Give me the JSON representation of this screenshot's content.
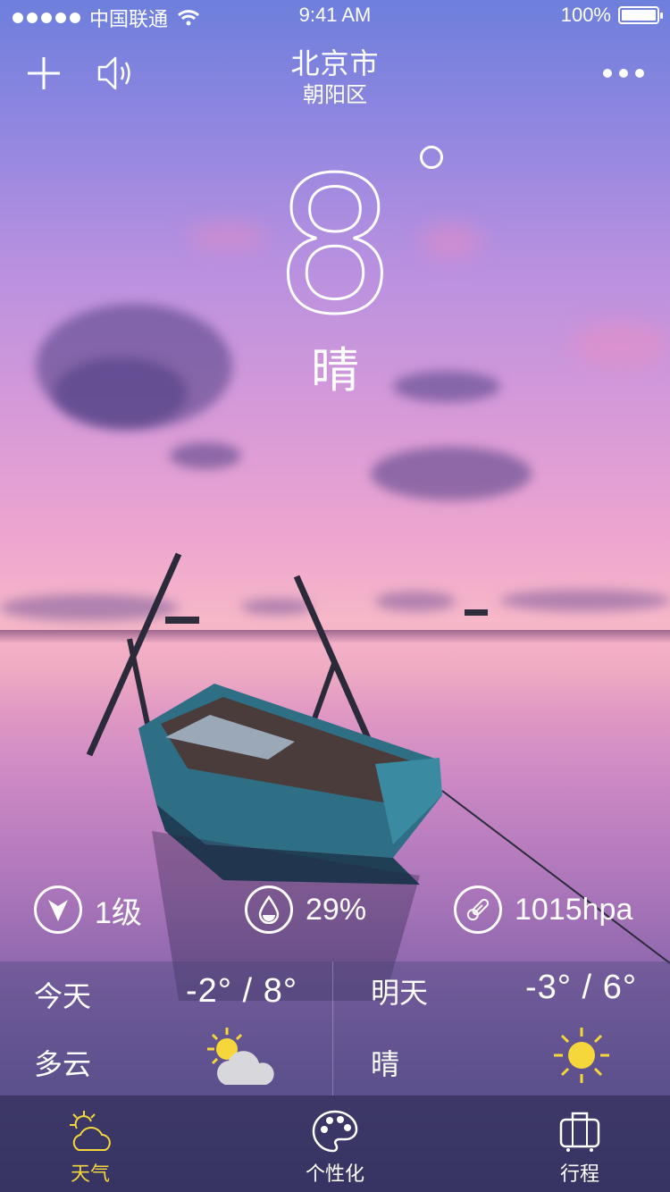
{
  "status_bar": {
    "carrier": "中国联通",
    "time": "9:41 AM",
    "battery": "100%"
  },
  "header": {
    "city": "北京市",
    "district": "朝阳区",
    "add_icon": "plus-icon",
    "sound_icon": "speaker-icon",
    "more_icon": "more-dots-icon"
  },
  "current": {
    "temperature": "8",
    "condition": "晴"
  },
  "stats": {
    "wind": {
      "icon": "wind-direction-icon",
      "value": "1级"
    },
    "humidity": {
      "icon": "water-drop-icon",
      "value": "29%"
    },
    "pressure": {
      "icon": "thermometer-icon",
      "value": "1015hpa"
    }
  },
  "forecast": [
    {
      "day": "今天",
      "low": "-2",
      "high": "8",
      "condition": "多云",
      "icon": "partly-cloudy-icon"
    },
    {
      "day": "明天",
      "low": "-3",
      "high": "6",
      "condition": "晴",
      "icon": "sunny-icon"
    }
  ],
  "tabs": [
    {
      "label": "天气",
      "icon": "weather-icon",
      "active": true
    },
    {
      "label": "个性化",
      "icon": "palette-icon",
      "active": false
    },
    {
      "label": "行程",
      "icon": "luggage-icon",
      "active": false
    }
  ],
  "colors": {
    "active_tab": "#f5d63b",
    "sun": "#f5d63b",
    "text": "#ffffff"
  }
}
